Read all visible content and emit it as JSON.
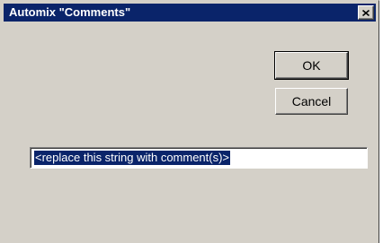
{
  "window": {
    "title": "Automix \"Comments\"",
    "close_icon": "close-icon"
  },
  "buttons": {
    "ok_label": "OK",
    "cancel_label": "Cancel"
  },
  "comment_field": {
    "value": "<replace this string with comment(s)>",
    "selected": true
  },
  "colors": {
    "titlebar": "#0a246a",
    "dialog_bg": "#d4d0c8",
    "selection": "#0a246a"
  }
}
